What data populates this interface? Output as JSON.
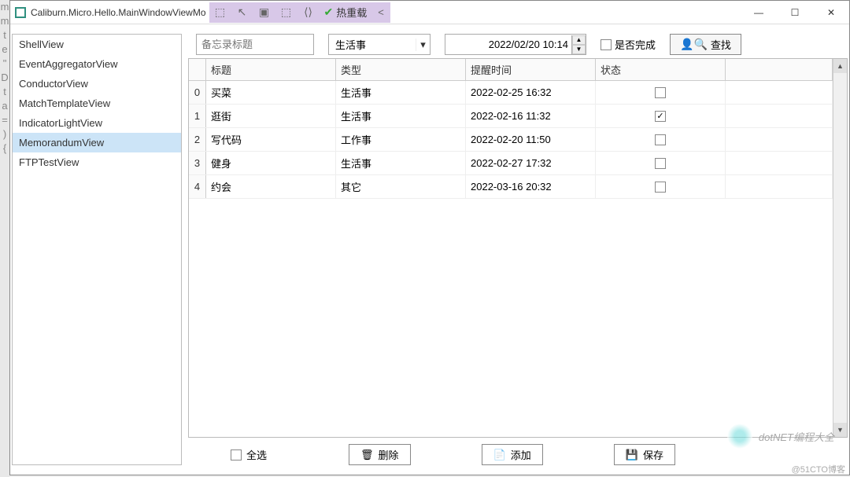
{
  "window": {
    "title": "Caliburn.Micro.Hello.MainWindowViewMo",
    "hot_reload": "热重载"
  },
  "left_gutter": [
    "",
    "m",
    "",
    "m",
    "t",
    "",
    "",
    "",
    "",
    "",
    "e",
    "\"",
    "",
    "",
    "",
    "D",
    "t",
    "a",
    "=",
    ")",
    "",
    "",
    "{",
    ""
  ],
  "sidebar": {
    "items": [
      {
        "label": "ShellView",
        "selected": false
      },
      {
        "label": "EventAggregatorView",
        "selected": false
      },
      {
        "label": "ConductorView",
        "selected": false
      },
      {
        "label": "MatchTemplateView",
        "selected": false
      },
      {
        "label": "IndicatorLightView",
        "selected": false
      },
      {
        "label": "MemorandumView",
        "selected": true
      },
      {
        "label": "FTPTestView",
        "selected": false
      }
    ]
  },
  "filter": {
    "title_placeholder": "备忘录标题",
    "type_selected": "生活事",
    "datetime": "2022/02/20 10:14",
    "done_label": "是否完成",
    "search_label": "查找"
  },
  "grid": {
    "columns": [
      "标题",
      "类型",
      "提醒时间",
      "状态"
    ],
    "rows": [
      {
        "idx": "0",
        "title": "买菜",
        "type": "生活事",
        "time": "2022-02-25 16:32",
        "done": false
      },
      {
        "idx": "1",
        "title": "逛街",
        "type": "生活事",
        "time": "2022-02-16 11:32",
        "done": true
      },
      {
        "idx": "2",
        "title": "写代码",
        "type": "工作事",
        "time": "2022-02-20 11:50",
        "done": false
      },
      {
        "idx": "3",
        "title": "健身",
        "type": "生活事",
        "time": "2022-02-27 17:32",
        "done": false
      },
      {
        "idx": "4",
        "title": "约会",
        "type": "其它",
        "time": "2022-03-16 20:32",
        "done": false
      }
    ]
  },
  "bottom": {
    "select_all": "全选",
    "delete": "删除",
    "add": "添加",
    "save": "保存"
  },
  "watermark": "dotNET编程大全",
  "footer_credit": "@51CTO博客"
}
